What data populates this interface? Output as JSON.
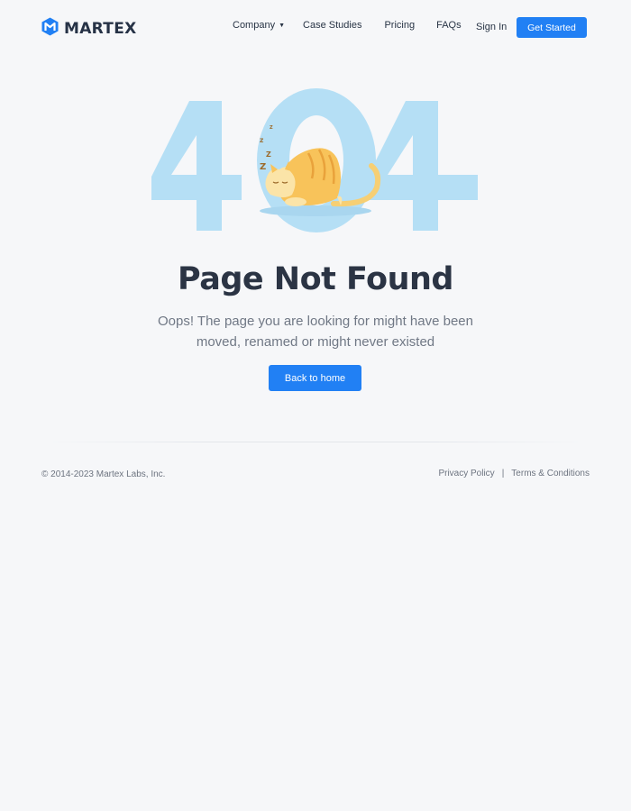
{
  "brand": {
    "name": "MARTEX",
    "accent": "#2180f4",
    "icon": "martex-logo-icon"
  },
  "nav": {
    "items": [
      {
        "label": "Company",
        "has_dropdown": true
      },
      {
        "label": "Case Studies"
      },
      {
        "label": "Pricing"
      },
      {
        "label": "FAQs"
      }
    ],
    "sign_in": "Sign In",
    "get_started": "Get Started"
  },
  "hero": {
    "code": "404",
    "illustration": "sleeping-cat-illustration",
    "digit_color": "#b5dff5",
    "title": "Page Not Found",
    "subtitle": "Oops! The page you are looking for might have been moved, renamed or might never existed",
    "button": "Back to home"
  },
  "footer": {
    "copyright": "© 2014-2023 Martex Labs, Inc.",
    "links": [
      "Privacy Policy",
      "Terms & Conditions"
    ],
    "separator": "|"
  }
}
